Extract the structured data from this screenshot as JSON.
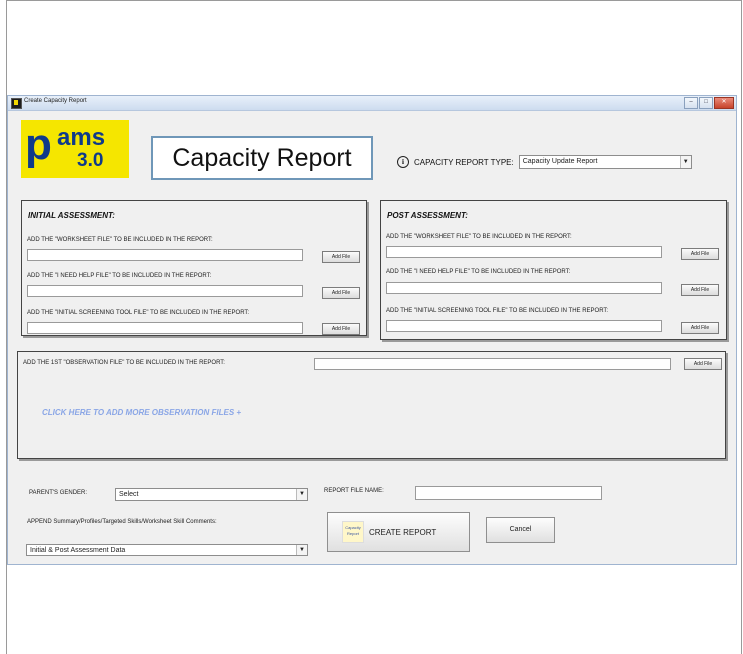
{
  "window": {
    "title": "Create Capacity Report",
    "controls": {
      "minimize": "–",
      "maximize": "□",
      "close": "✕"
    }
  },
  "logo": {
    "letter": "p",
    "text": "ams",
    "version": "3.0"
  },
  "report_title": "Capacity Report",
  "report_type": {
    "info_icon": "i",
    "label": "CAPACITY REPORT TYPE:",
    "value": "Capacity Update Report"
  },
  "initial": {
    "title": "INITIAL ASSESSMENT:",
    "rows": [
      {
        "label": "ADD THE \"WORKSHEET FILE\" TO BE INCLUDED IN THE REPORT:",
        "button": "Add File"
      },
      {
        "label": "ADD THE \"I NEED HELP FILE\" TO BE INCLUDED IN THE REPORT:",
        "button": "Add File"
      },
      {
        "label": "ADD THE \"INITIAL SCREENING TOOL FILE\" TO BE INCLUDED IN THE REPORT:",
        "button": "Add File"
      }
    ]
  },
  "post": {
    "title": "POST ASSESSMENT:",
    "rows": [
      {
        "label": "ADD THE \"WORKSHEET FILE\" TO BE INCLUDED IN THE REPORT:",
        "button": "Add File"
      },
      {
        "label": "ADD THE \"I NEED HELP FILE\" TO BE INCLUDED IN THE REPORT:",
        "button": "Add File"
      },
      {
        "label": "ADD THE \"INITIAL SCREENING TOOL FILE\" TO BE INCLUDED IN THE REPORT:",
        "button": "Add File"
      }
    ]
  },
  "observation": {
    "label": "ADD THE 1ST \"OBSERVATION FILE\" TO BE INCLUDED IN THE REPORT:",
    "button": "Add File",
    "more_link": "CLICK HERE TO ADD MORE OBSERVATION FILES +"
  },
  "bottom": {
    "gender_label": "PARENT'S GENDER:",
    "gender_value": "Select",
    "filename_label": "REPORT FILE NAME:",
    "append_label": "APPEND Summary/Profiles/Targeted Skills/Worksheet Skill Comments:",
    "append_value": "Initial & Post Assessment Data",
    "create_icon_text": "Capacity Report",
    "create_label": "CREATE REPORT",
    "cancel_label": "Cancel"
  }
}
